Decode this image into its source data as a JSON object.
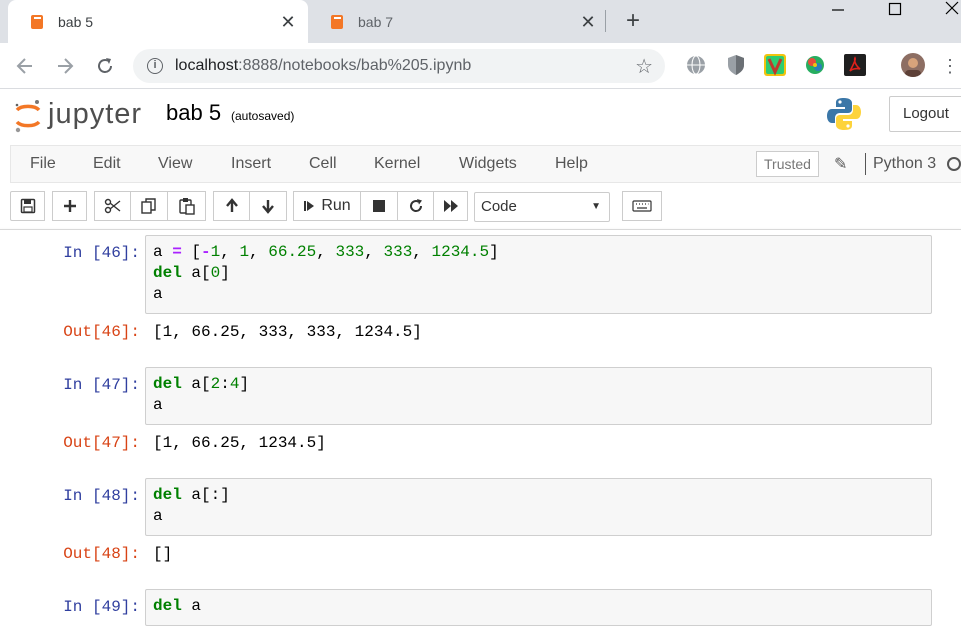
{
  "browser": {
    "tabs": [
      {
        "label": "bab 5",
        "active": true
      },
      {
        "label": "bab 7",
        "active": false
      }
    ],
    "url_host": "localhost",
    "url_path": ":8888/notebooks/bab%205.ipynb"
  },
  "jupyter": {
    "logo_text": "jupyter",
    "notebook_name": "bab 5",
    "autosave_status": "(autosaved)",
    "logout_label": "Logout",
    "menu": [
      "File",
      "Edit",
      "View",
      "Insert",
      "Cell",
      "Kernel",
      "Widgets",
      "Help"
    ],
    "trusted_label": "Trusted",
    "kernel_name": "Python 3",
    "run_label": "Run",
    "cell_type": "Code"
  },
  "cells": [
    {
      "in_prompt": "In [46]:",
      "source_lines": [
        [
          {
            "t": "a ",
            "c": ""
          },
          {
            "t": "=",
            "c": "op"
          },
          {
            "t": " [",
            "c": ""
          },
          {
            "t": "-",
            "c": "op"
          },
          {
            "t": "1",
            "c": "num"
          },
          {
            "t": ", ",
            "c": ""
          },
          {
            "t": "1",
            "c": "num"
          },
          {
            "t": ", ",
            "c": ""
          },
          {
            "t": "66.25",
            "c": "num"
          },
          {
            "t": ", ",
            "c": ""
          },
          {
            "t": "333",
            "c": "num"
          },
          {
            "t": ", ",
            "c": ""
          },
          {
            "t": "333",
            "c": "num"
          },
          {
            "t": ", ",
            "c": ""
          },
          {
            "t": "1234.5",
            "c": "num"
          },
          {
            "t": "]",
            "c": ""
          }
        ],
        [
          {
            "t": "del",
            "c": "kw"
          },
          {
            "t": " a[",
            "c": ""
          },
          {
            "t": "0",
            "c": "num"
          },
          {
            "t": "]",
            "c": ""
          }
        ],
        [
          {
            "t": "a",
            "c": ""
          }
        ]
      ],
      "out_prompt": "Out[46]:",
      "output": "[1, 66.25, 333, 333, 1234.5]"
    },
    {
      "in_prompt": "In [47]:",
      "source_lines": [
        [
          {
            "t": "del",
            "c": "kw"
          },
          {
            "t": " a[",
            "c": ""
          },
          {
            "t": "2",
            "c": "num"
          },
          {
            "t": ":",
            "c": ""
          },
          {
            "t": "4",
            "c": "num"
          },
          {
            "t": "]",
            "c": ""
          }
        ],
        [
          {
            "t": "a",
            "c": ""
          }
        ]
      ],
      "out_prompt": "Out[47]:",
      "output": "[1, 66.25, 1234.5]"
    },
    {
      "in_prompt": "In [48]:",
      "source_lines": [
        [
          {
            "t": "del",
            "c": "kw"
          },
          {
            "t": " a[:]",
            "c": ""
          }
        ],
        [
          {
            "t": "a",
            "c": ""
          }
        ]
      ],
      "out_prompt": "Out[48]:",
      "output": "[]"
    },
    {
      "in_prompt": "In [49]:",
      "source_lines": [
        [
          {
            "t": "del",
            "c": "kw"
          },
          {
            "t": " a",
            "c": ""
          }
        ]
      ],
      "out_prompt": "",
      "output": ""
    }
  ],
  "colors": {
    "jupyter_orange": "#f37726",
    "in_prompt": "#303f9f",
    "out_prompt": "#d84315",
    "keyword": "#008000",
    "operator": "#aa22ff"
  }
}
